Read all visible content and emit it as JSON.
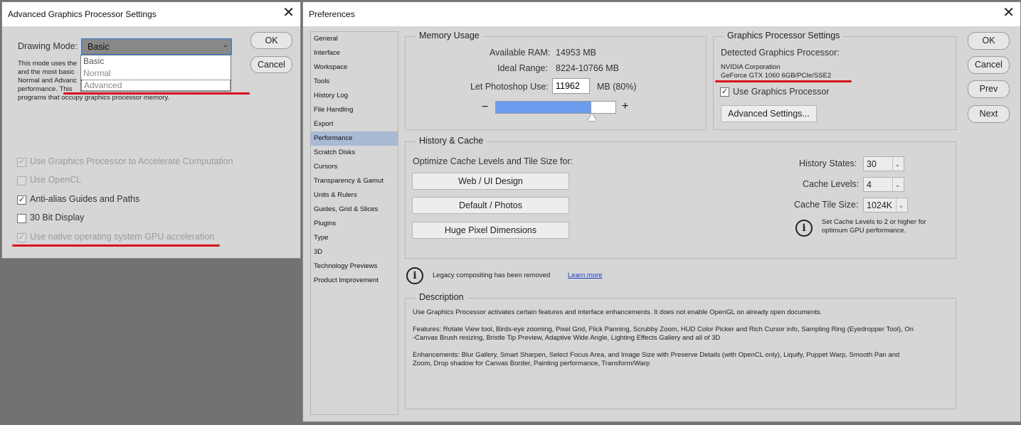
{
  "agps": {
    "title": "Advanced Graphics Processor Settings",
    "drawing_mode_label": "Drawing Mode:",
    "drawing_mode_value": "Basic",
    "dropdown_options": [
      "Basic",
      "Normal",
      "Advanced"
    ],
    "desc_lines": [
      "This mode uses the",
      "and the most basic",
      "Normal and Advanc",
      "performance.  This",
      "programs that occupy graphics processor memory."
    ],
    "ok": "OK",
    "cancel": "Cancel",
    "opt_accel": "Use Graphics Processor to Accelerate Computation",
    "opt_opencl": "Use OpenCL",
    "opt_antialias": "Anti-alias Guides and Paths",
    "opt_30bit": "30 Bit Display",
    "opt_native": "Use native operating system GPU acceleration"
  },
  "prefs": {
    "title": "Preferences",
    "sidebar": [
      "General",
      "Interface",
      "Workspace",
      "Tools",
      "History Log",
      "File Handling",
      "Export",
      "Performance",
      "Scratch Disks",
      "Cursors",
      "Transparency & Gamut",
      "Units & Rulers",
      "Guides, Grid & Slices",
      "Plugins",
      "Type",
      "3D",
      "Technology Previews",
      "Product Improvement"
    ],
    "active_item": "Performance",
    "buttons": {
      "ok": "OK",
      "cancel": "Cancel",
      "prev": "Prev",
      "next": "Next"
    },
    "memory": {
      "legend": "Memory Usage",
      "available_label": "Available RAM:",
      "available_value": "14953 MB",
      "ideal_label": "Ideal Range:",
      "ideal_value": "8224-10766 MB",
      "let_label": "Let Photoshop Use:",
      "let_value": "11962",
      "let_unit": "MB (80%)",
      "minus": "−",
      "plus": "+",
      "slider_fraction": 0.8
    },
    "gpu": {
      "legend": "Graphics Processor Settings",
      "detected_label": "Detected Graphics Processor:",
      "vendor": "NVIDIA Corporation",
      "model": "GeForce GTX 1060 6GB/PCIe/SSE2",
      "use_gpu": "Use Graphics Processor",
      "advanced_btn": "Advanced Settings..."
    },
    "history": {
      "legend": "History & Cache",
      "optimize_label": "Optimize Cache Levels and Tile Size for:",
      "btn_web": "Web / UI Design",
      "btn_default": "Default / Photos",
      "btn_huge": "Huge Pixel Dimensions",
      "states_label": "History States:",
      "states_value": "30",
      "levels_label": "Cache Levels:",
      "levels_value": "4",
      "tile_label": "Cache Tile Size:",
      "tile_value": "1024K",
      "info_line1": "Set Cache Levels to 2 or higher for",
      "info_line2": "optimum GPU performance."
    },
    "legacy": {
      "text": "Legacy compositing has been removed",
      "link": "Learn more"
    },
    "description": {
      "legend": "Description",
      "p1": "Use Graphics Processor activates certain features and interface enhancements. It does not enable OpenGL on already open documents.",
      "p2a": "Features: Rotate View tool, Birds-eye zooming, Pixel Grid, Flick Panning, Scrubby Zoom, HUD Color Picker and Rich Cursor info, Sampling Ring (Eyedropper Tool), On",
      "p2b": "-Canvas Brush resizing, Bristle Tip Preview, Adaptive Wide Angle, Lighting Effects Gallery and all of 3D",
      "p3a": "Enhancements: Blur Gallery, Smart Sharpen, Select Focus Area, and Image Size with Preserve Details (with OpenCL only), Liquify, Puppet Warp, Smooth Pan and",
      "p3b": "Zoom, Drop shadow for Canvas Border, Painting performance, Transform/Warp"
    }
  },
  "colors": {
    "highlight_line": "#d8121b",
    "slider_fill": "#6b9cf0",
    "active_nav": "#a8bad4"
  }
}
